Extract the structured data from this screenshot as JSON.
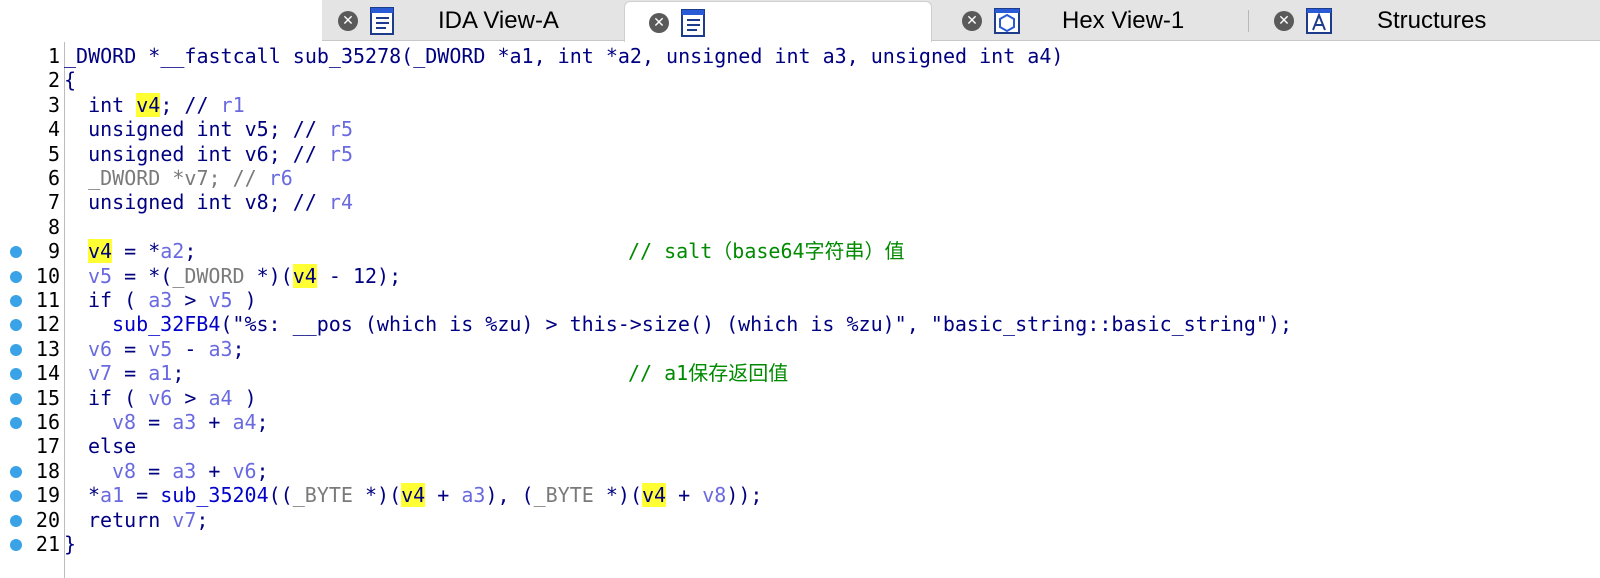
{
  "tabs": [
    {
      "label": "IDA View-A",
      "icon": "disassembly-icon",
      "active": false
    },
    {
      "label": "",
      "icon": "pseudocode-icon",
      "active": true
    },
    {
      "label": "Hex View-1",
      "icon": "hex-icon",
      "active": false
    },
    {
      "label": "Structures",
      "icon": "structures-icon",
      "active": false
    }
  ],
  "colors": {
    "breakpoint": "#3aa2e6",
    "highlight": "#ffff33",
    "comment": "#008a00",
    "keyword": "#000080",
    "variable": "#6a6ae0"
  },
  "lines": [
    {
      "n": "1",
      "bp": false
    },
    {
      "n": "2",
      "bp": false
    },
    {
      "n": "3",
      "bp": false
    },
    {
      "n": "4",
      "bp": false
    },
    {
      "n": "5",
      "bp": false
    },
    {
      "n": "6",
      "bp": false
    },
    {
      "n": "7",
      "bp": false
    },
    {
      "n": "8",
      "bp": false
    },
    {
      "n": "9",
      "bp": true
    },
    {
      "n": "10",
      "bp": true
    },
    {
      "n": "11",
      "bp": true
    },
    {
      "n": "12",
      "bp": true
    },
    {
      "n": "13",
      "bp": true
    },
    {
      "n": "14",
      "bp": true
    },
    {
      "n": "15",
      "bp": true
    },
    {
      "n": "16",
      "bp": true
    },
    {
      "n": "17",
      "bp": false
    },
    {
      "n": "18",
      "bp": true
    },
    {
      "n": "19",
      "bp": true
    },
    {
      "n": "20",
      "bp": true
    },
    {
      "n": "21",
      "bp": true
    }
  ],
  "code": {
    "l1": "_DWORD *__fastcall sub_35278(_DWORD *a1, int *a2, unsigned int a3, unsigned int a4)",
    "l2": "{",
    "l3_a": "  int ",
    "l3_v": "v4",
    "l3_b": "; // ",
    "l3_r": "r1",
    "l4_a": "  unsigned int v5; // ",
    "l4_r": "r5",
    "l5_a": "  unsigned int v6; // ",
    "l5_r": "r5",
    "l6_a": "  _DWORD *v7; // ",
    "l6_r": "r6",
    "l7_a": "  unsigned int v8; // ",
    "l7_r": "r4",
    "l9_v": "v4",
    "l9_b": " = *",
    "l9_c": "a2",
    "l9_d": ";",
    "l9_cmt": "// salt（base64字符串）值",
    "l10_a": "v5",
    "l10_b": " = *(",
    "l10_c": "_DWORD",
    "l10_d": " *)(",
    "l10_v": "v4",
    "l10_e": " - 12);",
    "l11_a": "if ( ",
    "l11_b": "a3",
    "l11_c": " > ",
    "l11_d": "v5",
    "l11_e": " )",
    "l12_fn": "sub_32FB4",
    "l12_rest": "(\"%s: __pos (which is %zu) > this->size() (which is %zu)\", \"basic_string::basic_string\");",
    "l13_a": "v6",
    "l13_b": " = ",
    "l13_c": "v5",
    "l13_d": " - ",
    "l13_e": "a3",
    "l13_f": ";",
    "l14_a": "v7",
    "l14_b": " = ",
    "l14_c": "a1",
    "l14_d": ";",
    "l14_cmt": "// a1保存返回值",
    "l15_a": "if ( ",
    "l15_b": "v6",
    "l15_c": " > ",
    "l15_d": "a4",
    "l15_e": " )",
    "l16_a": "v8",
    "l16_b": " = ",
    "l16_c": "a3",
    "l16_d": " + ",
    "l16_e": "a4",
    "l16_f": ";",
    "l17": "else",
    "l18_a": "v8",
    "l18_b": " = ",
    "l18_c": "a3",
    "l18_d": " + ",
    "l18_e": "v6",
    "l18_f": ";",
    "l19_a": "*",
    "l19_b": "a1",
    "l19_c": " = ",
    "l19_fn": "sub_35204",
    "l19_d": "((",
    "l19_e": "_BYTE",
    "l19_f": " *)(",
    "l19_v1": "v4",
    "l19_g": " + ",
    "l19_h": "a3",
    "l19_i": "), (",
    "l19_j": "_BYTE",
    "l19_k": " *)(",
    "l19_v2": "v4",
    "l19_l": " + ",
    "l19_m": "v8",
    "l19_n": "));",
    "l20_a": "return ",
    "l20_b": "v7",
    "l20_c": ";",
    "l21": "}"
  }
}
